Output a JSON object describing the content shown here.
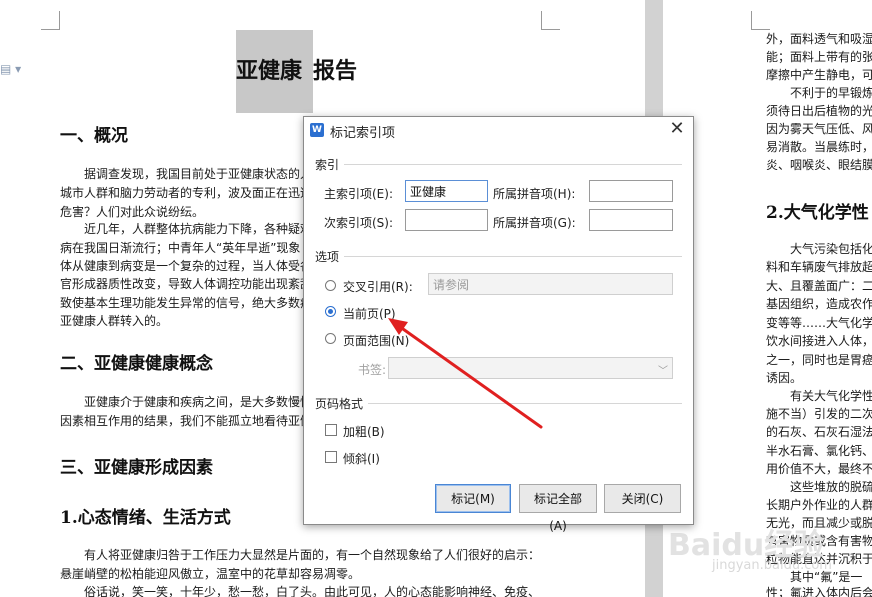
{
  "document": {
    "title_highlighted": "亚健康",
    "title_rest": "报告",
    "left_sections": {
      "h_overview": "一、概况",
      "p1_lines": [
        "据调查发现，我国目前处于亚健康状态的人",
        "城市人群和脑力劳动者的专利，波及面正在迅速",
        "危害？人们对此众说纷纭。"
      ],
      "p2_lines": [
        "近几年，人群整体抗病能力下降，各种疑难",
        "病在我国日渐流行；中青年人“英年早逝”现象",
        "体从健康到病变是一个复杂的过程，当人体受各",
        "官形成器质性改变，导致人体调控功能出现紊乱",
        "致使基本生理功能发生异常的信号，绝大多数病",
        "亚健康人群转入的。"
      ],
      "h_concept": "二、亚健康健康概念",
      "p3_lines": [
        "亚健康介于健康和疾病之间，是大多数慢性",
        "因素相互作用的结果，我们不能孤立地看待亚健"
      ],
      "h_factors": "三、亚健康形成因素",
      "h_lifestyle": "1.心态情绪、生活方式",
      "p4_lines": [
        "有人将亚健康归咎于工作压力大显然是片面的，有一个自然现象给了人们很好的启示：",
        "悬崖峭壁的松柏能迎风傲立，温室中的花草却容易凋零。",
        "俗话说，笑一笑，十年少，愁一愁，白了头。由此可见，人的心态能影响神经、免疫、"
      ]
    },
    "right_sections": {
      "p_top_lines": [
        "外，面料透气和吸湿",
        "能；面料上带有的张",
        "摩擦中产生静电，可"
      ],
      "p_top2_lines": [
        "不利于的早锻炼",
        "须待日出后植物的光",
        "因为雾天气压低、风",
        "易消散。当晨练时，",
        "炎、咽喉炎、眼结膜"
      ],
      "h_chem": "2.大气化学性",
      "p_chem_lines": [
        "大气污染包括化",
        "料和车辆废气排放超",
        "大、且覆盖面广：二",
        "基因组织，造成农作",
        "变等等……大气化学",
        "饮水间接进入人体，",
        "之一，同时也是胃癌",
        "诱因。"
      ],
      "p_chem2_lines": [
        "有关大气化学性",
        "施不当）引发的二次",
        "的石灰、石灰石湿法",
        "半水石膏、氯化钙、",
        "用价值不大，最终不"
      ],
      "p_chem3_lines": [
        "这些堆放的脱硫",
        "长期户外作业的人群",
        "无光，而且减少或脱",
        "有害物质或含有害物",
        "粒物能直达并沉积于"
      ],
      "p_chem4_lines": [
        "其中“氟”是一",
        "性；氟进入体内后会"
      ]
    },
    "watermark": "Baidu经验",
    "watermark_sub": "jingyan.baidu.com"
  },
  "dialog": {
    "app_icon_label": "W",
    "title": "标记索引项",
    "close_glyph": "✕",
    "index_section": "索引",
    "main_entry_label": "主索引项(E):",
    "main_entry_value": "亚健康",
    "main_pinyin_label": "所属拼音项(H):",
    "main_pinyin_value": "",
    "sub_entry_label": "次索引项(S):",
    "sub_entry_value": "",
    "sub_pinyin_label": "所属拼音项(G):",
    "sub_pinyin_value": "",
    "options_section": "选项",
    "cross_ref_label": "交叉引用(R):",
    "cross_ref_value": "请参阅",
    "current_page_label": "当前页(P)",
    "page_range_label": "页面范围(N)",
    "bookmark_label": "书签:",
    "bookmark_value": "",
    "page_format_section": "页码格式",
    "bold_label": "加粗(B)",
    "italic_label": "倾斜(I)",
    "mark_button": "标记(M)",
    "mark_all_button": "标记全部(A)",
    "close_button": "关闭(C)",
    "selected_option": "current_page",
    "bold_checked": false,
    "italic_checked": false
  },
  "colors": {
    "accent": "#2b6fd0",
    "annotation_arrow": "#e02020",
    "highlight": "#c8c8c8"
  }
}
